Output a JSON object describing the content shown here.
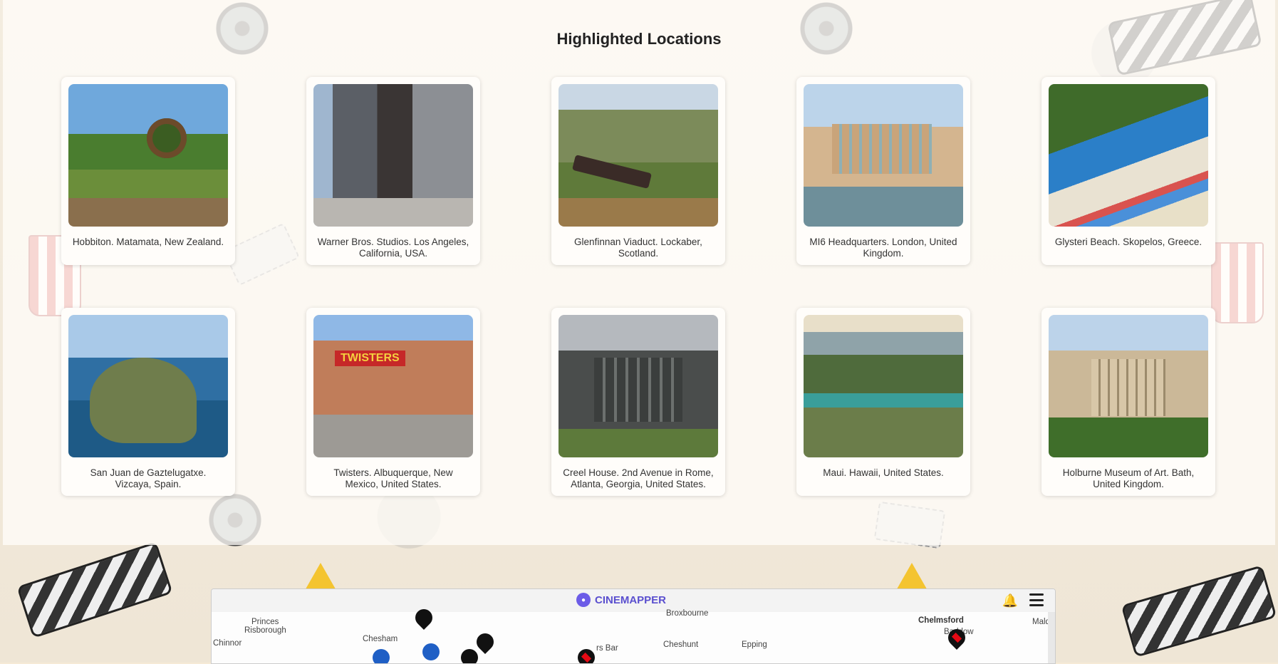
{
  "highlights": {
    "title": "Highlighted Locations",
    "locations": [
      {
        "caption": "Hobbiton. Matamata, New Zealand."
      },
      {
        "caption": "Warner Bros. Studios. Los Angeles, California, USA."
      },
      {
        "caption": "Glenfinnan Viaduct. Lockaber, Scotland."
      },
      {
        "caption": "MI6 Headquarters. London, United Kingdom."
      },
      {
        "caption": "Glysteri Beach. Skopelos, Greece."
      },
      {
        "caption": "San Juan de Gaztelugatxe. Vizcaya, Spain."
      },
      {
        "caption": "Twisters. Albuquerque, New Mexico, United States."
      },
      {
        "caption": "Creel House. 2nd Avenue in Rome, Atlanta, Georgia, United States."
      },
      {
        "caption": "Maui. Hawaii, United States."
      },
      {
        "caption": "Holburne Museum of Art. Bath, United Kingdom."
      }
    ]
  },
  "map": {
    "brand": "CINEMAPPER",
    "brand_color": "#5a4fcf",
    "icons": [
      "bell-icon",
      "menu-icon"
    ],
    "towns": [
      {
        "name": "Princes"
      },
      {
        "name": "Risborough"
      },
      {
        "name": "Chinnor"
      },
      {
        "name": "Chesham"
      },
      {
        "name": "Broxbourne"
      },
      {
        "name": "Cheshunt"
      },
      {
        "name": "rs Bar"
      },
      {
        "name": "Epping"
      },
      {
        "name": "Chelmsford"
      },
      {
        "name": "Baddow"
      },
      {
        "name": "Maldo"
      }
    ]
  }
}
